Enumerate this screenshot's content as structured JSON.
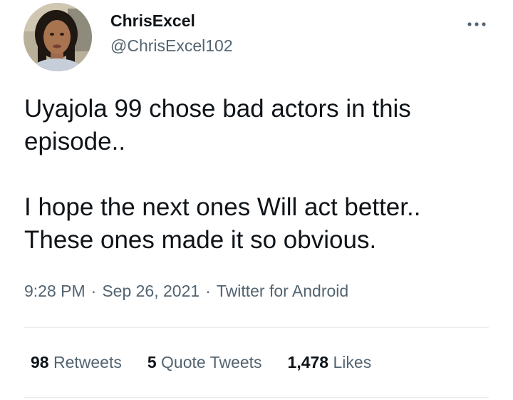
{
  "user": {
    "display_name": "ChrisExcel",
    "handle": "@ChrisExcel102",
    "avatar": "profile-photo"
  },
  "menu": {
    "icon": "more-horizontal-icon"
  },
  "tweet": {
    "line1": "Uyajola 99 chose bad actors in this",
    "line2": "episode..",
    "line3": "I hope the next ones Will act better..",
    "line4": "These ones made it so obvious."
  },
  "meta": {
    "time": "9:28 PM",
    "separator1": "·",
    "date": "Sep 26, 2021",
    "separator2": "·",
    "source": "Twitter for Android"
  },
  "stats": {
    "retweets_count": "98",
    "retweets_label": "Retweets",
    "quotes_count": "5",
    "quotes_label": "Quote Tweets",
    "likes_count": "1,478",
    "likes_label": "Likes"
  },
  "colors": {
    "primary_text": "#0f1419",
    "secondary_text": "#536471",
    "divider": "#e7ebee",
    "background": "#ffffff"
  }
}
